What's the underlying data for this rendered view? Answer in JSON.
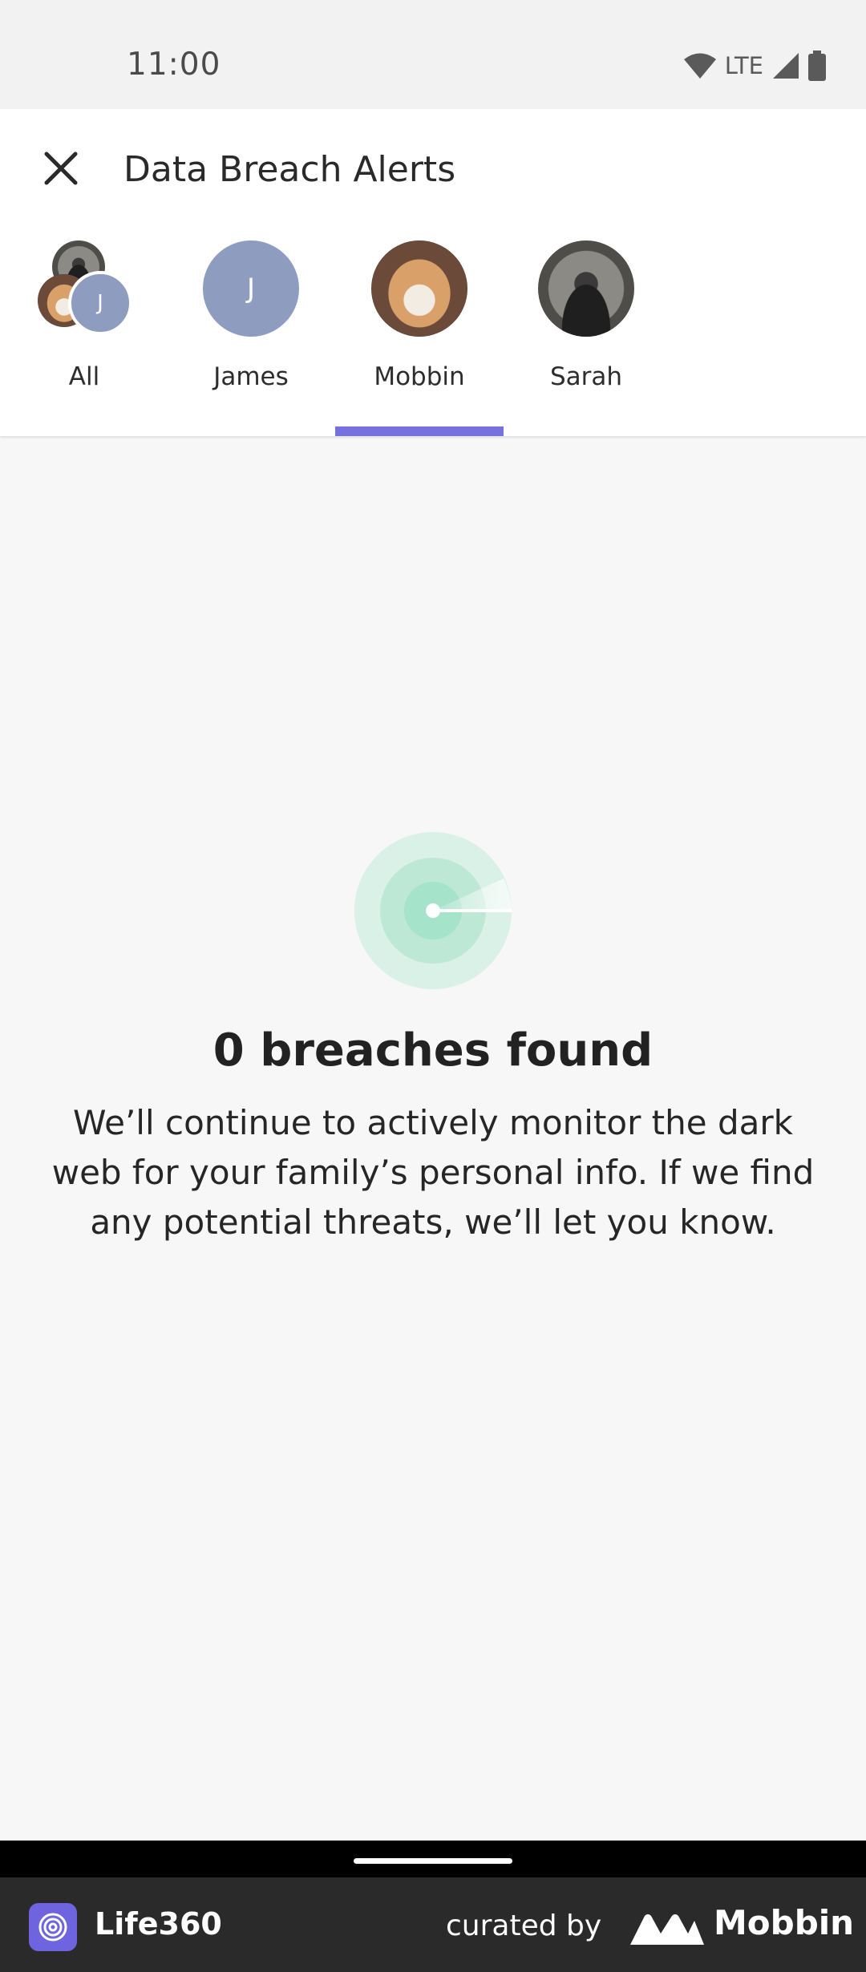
{
  "status_bar": {
    "time": "11:00",
    "network": "LTE"
  },
  "header": {
    "title": "Data Breach Alerts"
  },
  "tabs": [
    {
      "label": "All",
      "avatar": "group-avatar",
      "selected": false
    },
    {
      "label": "James",
      "avatar": "J",
      "selected": false
    },
    {
      "label": "Mobbin",
      "avatar": "dog-photo",
      "selected": true
    },
    {
      "label": "Sarah",
      "avatar": "person-photo",
      "selected": false
    }
  ],
  "group_avatar_letter": "J",
  "empty_state": {
    "title": "0 breaches found",
    "body": "We’ll continue to actively monitor the dark web for your family’s personal info. If we find any potential threats, we’ll let you know.",
    "icon": "radar-icon"
  },
  "footer": {
    "app_name": "Life360",
    "curated_by": "curated by",
    "brand": "Mobbin"
  },
  "colors": {
    "accent": "#7572df",
    "avatar_letter_bg": "#8e9cc0",
    "radar": "#a6e3cb"
  }
}
